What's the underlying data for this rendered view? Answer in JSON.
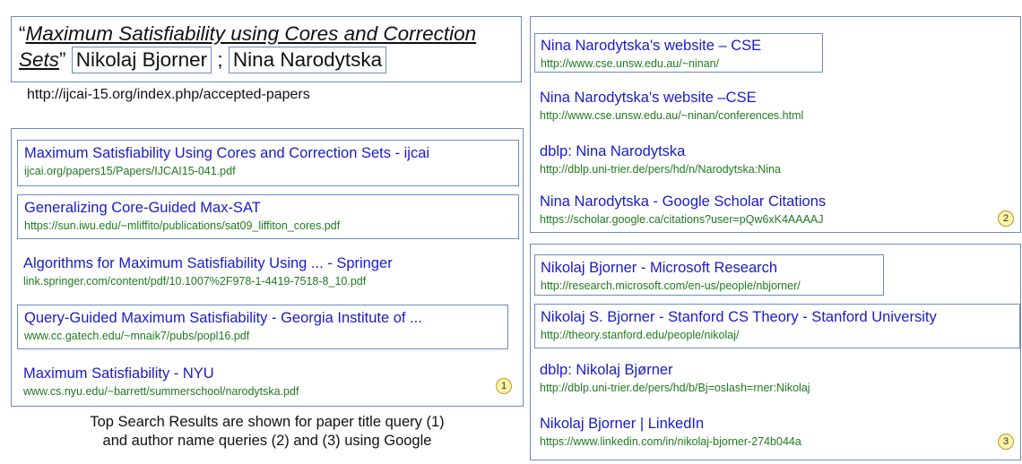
{
  "query": {
    "open_quote": "“",
    "title_part1": "Maximum Satisfiability using Cores and Correction",
    "title_part2": "Sets",
    "close_quote": "”",
    "author1": "Nikolaj Bjorner",
    "separator": " ; ",
    "author2": "Nina  Narodytska",
    "url": "http://ijcai-15.org/index.php/accepted-papers"
  },
  "panel1": {
    "marker": "1",
    "results": [
      {
        "title": "Maximum Satisfiability Using Cores and Correction Sets - ijcai",
        "url": "ijcai.org/papers15/Papers/IJCAI15-041.pdf"
      },
      {
        "title": "Generalizing Core-Guided Max-SAT",
        "url": "https://sun.iwu.edu/~mliffito/publications/sat09_liffiton_cores.pdf"
      },
      {
        "title": "Algorithms for Maximum Satisfiability Using ... - Springer",
        "url": "link.springer.com/content/pdf/10.1007%2F978-1-4419-7518-8_10.pdf"
      },
      {
        "title": "Query-Guided Maximum Satisfiability - Georgia Institute of ...",
        "url": "www.cc.gatech.edu/~mnaik7/pubs/popl16.pdf"
      },
      {
        "title": "Maximum Satisfiability - NYU",
        "url": "www.cs.nyu.edu/~barrett/summerschool/narodytska.pdf"
      }
    ]
  },
  "panel2": {
    "marker": "2",
    "results": [
      {
        "title": "Nina Narodytska's website – CSE",
        "url": "http://www.cse.unsw.edu.au/~ninan/"
      },
      {
        "title": "Nina Narodytska's website –CSE",
        "url": "http://www.cse.unsw.edu.au/~ninan/conferences.html"
      },
      {
        "title": "dblp: Nina Narodytska",
        "url": "http://dblp.uni-trier.de/pers/hd/n/Narodytska:Nina"
      },
      {
        "title": "Nina Narodytska - Google Scholar Citations",
        "url": "https://scholar.google.ca/citations?user=pQw6xK4AAAAJ"
      }
    ]
  },
  "panel3": {
    "marker": "3",
    "results": [
      {
        "title": "Nikolaj Bjorner - Microsoft Research",
        "url": "http://research.microsoft.com/en-us/people/nbjorner/"
      },
      {
        "title": "Nikolaj S. Bjorner - Stanford CS Theory - Stanford University",
        "url": "http://theory.stanford.edu/people/nikolaj/"
      },
      {
        "title": "dblp: Nikolaj Bjørner",
        "url": "http://dblp.uni-trier.de/pers/hd/b/Bj=oslash=rner:Nikolaj"
      },
      {
        "title": "Nikolaj Bjorner | LinkedIn",
        "url": "https://www.linkedin.com/in/nikolaj-bjorner-274b044a"
      }
    ]
  },
  "caption": {
    "line1": "Top Search Results are shown for paper title query (1)",
    "line2": "and author name queries (2) and (3) using Google"
  },
  "colors": {
    "link": "#1a1acc",
    "url": "#1f7a1f",
    "frame": "#6d8bbd",
    "marker_fill": "#fff3a8"
  }
}
